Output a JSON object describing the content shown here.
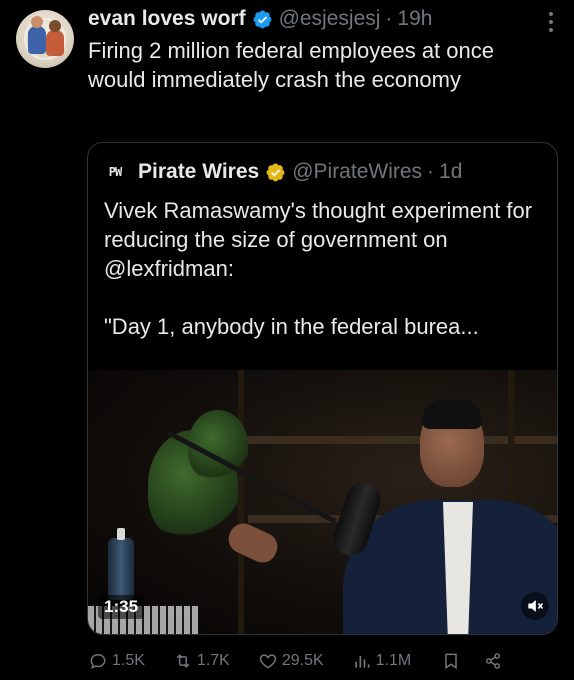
{
  "tweet": {
    "display_name": "evan loves worf",
    "handle": "@esjesjesj",
    "separator": "·",
    "time": "19h",
    "text": "Firing 2 million federal employees at once would immediately crash the economy"
  },
  "quote": {
    "logo_text": "PW",
    "display_name": "Pirate Wires",
    "handle": "@PirateWires",
    "separator": "·",
    "time": "1d",
    "text_line1": "Vivek Ramaswamy's thought experiment for reducing the size of government on @lexfridman:",
    "text_line2": "\"Day 1, anybody in the federal burea...",
    "media": {
      "duration": "1:35",
      "muted": true
    }
  },
  "actions": {
    "replies": "1.5K",
    "reposts": "1.7K",
    "likes": "29.5K",
    "views": "1.1M"
  },
  "colors": {
    "background": "#000000",
    "text_primary": "#e7e9ea",
    "text_secondary": "#71767b",
    "verified_blue": "#1d9bf0",
    "verified_gold": "#e2b719",
    "border": "#2f3336"
  }
}
